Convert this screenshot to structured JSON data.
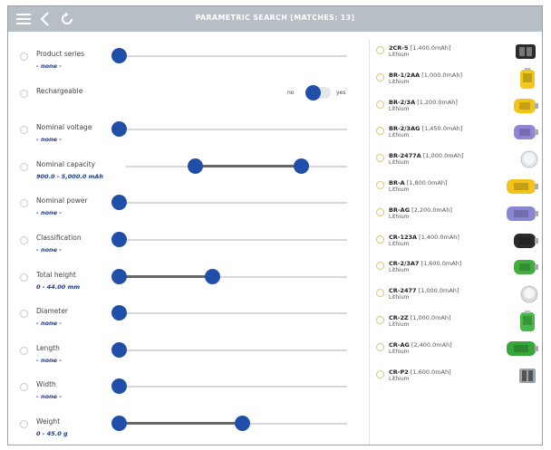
{
  "header": {
    "title": "PARAMETRIC SEARCH [MATCHES: 13]",
    "menu_icon": "menu-icon",
    "back_icon": "back-icon",
    "refresh_icon": "refresh-icon"
  },
  "filters": [
    {
      "label": "Product series",
      "value": "- none -",
      "control": "slider",
      "range": [
        0,
        0
      ]
    },
    {
      "label": "Rechargeable",
      "control": "toggle",
      "off_label": "no",
      "on_label": "yes"
    },
    {
      "label": "Nominal voltage",
      "value": "- none -",
      "control": "slider",
      "range": [
        0,
        0
      ]
    },
    {
      "label": "Nominal capacity",
      "value": "900.0 - 5,000.0 mAh",
      "control": "range",
      "range": [
        0.31,
        0.79
      ]
    },
    {
      "label": "Nominal power",
      "value": "- none -",
      "control": "slider",
      "range": [
        0,
        0
      ]
    },
    {
      "label": "Classification",
      "value": "- none -",
      "control": "slider",
      "range": [
        0,
        0
      ]
    },
    {
      "label": "Total height",
      "value": "0 - 44.00 mm",
      "control": "slider",
      "range": [
        0,
        0.41
      ]
    },
    {
      "label": "Diameter",
      "value": "- none -",
      "control": "slider",
      "range": [
        0,
        0
      ]
    },
    {
      "label": "Length",
      "value": "- none -",
      "control": "slider",
      "range": [
        0,
        0
      ]
    },
    {
      "label": "Width",
      "value": "- none -",
      "control": "slider",
      "range": [
        0,
        0
      ]
    },
    {
      "label": "Weight",
      "value": "0 - 45.0 g",
      "control": "slider",
      "range": [
        0,
        0.54
      ]
    }
  ],
  "batteries": [
    {
      "name": "2CR-5",
      "capacity": "[1,400.0mAh]",
      "chemistry": "Lithium",
      "shape": "square",
      "color": "#2b2b2b"
    },
    {
      "name": "BR-1/2AA",
      "capacity": "[1,000.0mAh]",
      "chemistry": "Lithium",
      "shape": "cell-upright",
      "color": "#f2c81e"
    },
    {
      "name": "BR-2/3A",
      "capacity": "[1,200.0mAh]",
      "chemistry": "Lithium",
      "shape": "cell",
      "color": "#f0c419"
    },
    {
      "name": "BR-2/3AG",
      "capacity": "[1,450.0mAh]",
      "chemistry": "Lithium",
      "shape": "cell",
      "color": "#8f86d6"
    },
    {
      "name": "BR-2477A",
      "capacity": "[1,000.0mAh]",
      "chemistry": "Lithium",
      "shape": "coin",
      "color": "#e6e8ea"
    },
    {
      "name": "BR-A",
      "capacity": "[1,800.0mAh]",
      "chemistry": "Lithium",
      "shape": "cell-long",
      "color": "#f1c31b"
    },
    {
      "name": "BR-AG",
      "capacity": "[2,200.0mAh]",
      "chemistry": "Lithium",
      "shape": "cell-long",
      "color": "#8b86d2"
    },
    {
      "name": "CR-123A",
      "capacity": "[1,400.0mAh]",
      "chemistry": "Lithium",
      "shape": "cell",
      "color": "#2a2a2a"
    },
    {
      "name": "CR-2/3A7",
      "capacity": "[1,600.0mAh]",
      "chemistry": "Lithium",
      "shape": "cell",
      "color": "#3fae3f"
    },
    {
      "name": "CR-2477",
      "capacity": "[1,000.0mAh]",
      "chemistry": "Lithium",
      "shape": "coin",
      "color": "#d8dadc"
    },
    {
      "name": "CR-2Z",
      "capacity": "[1,000.0mAh]",
      "chemistry": "Lithium",
      "shape": "cell-upright",
      "color": "#48b948"
    },
    {
      "name": "CR-AG",
      "capacity": "[2,400.0mAh]",
      "chemistry": "Lithium",
      "shape": "cell-long",
      "color": "#36a83a"
    },
    {
      "name": "CR-P2",
      "capacity": "[1,600.0mAh]",
      "chemistry": "Lithium",
      "shape": "pack",
      "color": "#9da3aa"
    }
  ]
}
